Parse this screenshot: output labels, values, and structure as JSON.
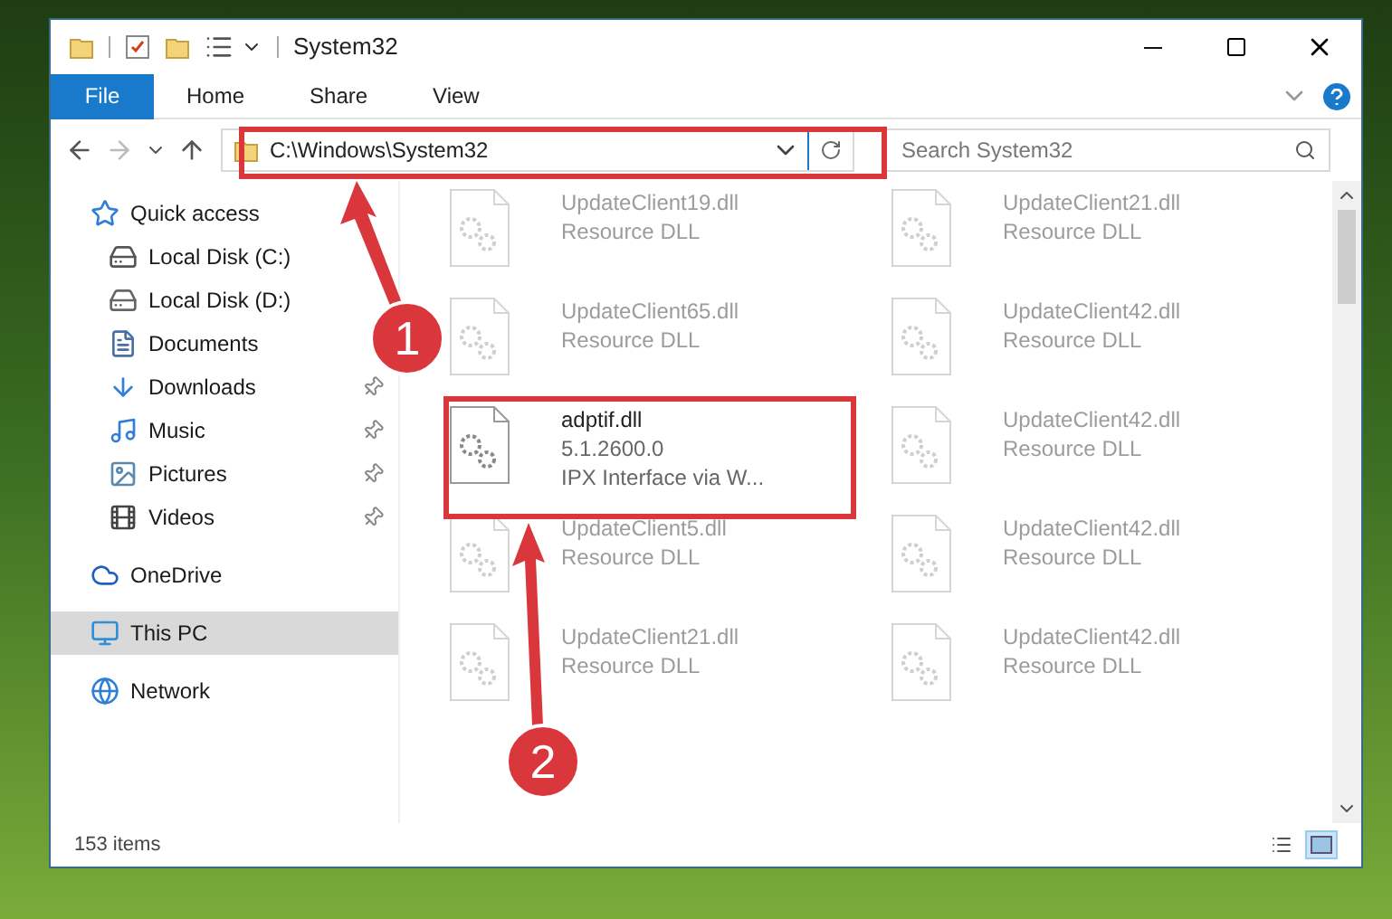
{
  "window": {
    "title": "System32"
  },
  "ribbon_tabs": [
    {
      "label": "File",
      "selected": true
    },
    {
      "label": "Home",
      "selected": false
    },
    {
      "label": "Share",
      "selected": false
    },
    {
      "label": "View",
      "selected": false
    }
  ],
  "address_bar": {
    "path": "C:\\Windows\\System32"
  },
  "search": {
    "placeholder": "Search System32"
  },
  "sidebar": {
    "items": [
      {
        "label": "Quick access",
        "kind": "quick",
        "selected": false,
        "children": [
          {
            "label": "Local Disk (C:)",
            "kind": "diskc",
            "pinned": false
          },
          {
            "label": "Local Disk (D:)",
            "kind": "disk",
            "pinned": false
          },
          {
            "label": "Documents",
            "kind": "documents",
            "pinned": false
          },
          {
            "label": "Downloads",
            "kind": "downloads",
            "pinned": true
          },
          {
            "label": "Music",
            "kind": "music",
            "pinned": true
          },
          {
            "label": "Pictures",
            "kind": "pictures",
            "pinned": true
          },
          {
            "label": "Videos",
            "kind": "videos",
            "pinned": true
          }
        ]
      },
      {
        "label": "OneDrive",
        "kind": "cloud",
        "selected": false
      },
      {
        "label": "This PC",
        "kind": "pc",
        "selected": true
      },
      {
        "label": "Network",
        "kind": "network",
        "selected": false
      }
    ]
  },
  "files": [
    {
      "name": "UpdateClient19.dll",
      "details": [
        "Resource DLL"
      ],
      "faded": true
    },
    {
      "name": "UpdateClient21.dll",
      "details": [
        "Resource DLL"
      ],
      "faded": true
    },
    {
      "name": "UpdateClient65.dll",
      "details": [
        "Resource DLL"
      ],
      "faded": true
    },
    {
      "name": "UpdateClient42.dll",
      "details": [
        "Resource DLL"
      ],
      "faded": true
    },
    {
      "name": "adptif.dll",
      "details": [
        "5.1.2600.0",
        "IPX Interface via W..."
      ],
      "faded": false
    },
    {
      "name": "UpdateClient42.dll",
      "details": [
        "Resource DLL"
      ],
      "faded": true
    },
    {
      "name": "UpdateClient5.dll",
      "details": [
        "Resource DLL"
      ],
      "faded": true
    },
    {
      "name": "UpdateClient42.dll",
      "details": [
        "Resource DLL"
      ],
      "faded": true
    },
    {
      "name": "UpdateClient21.dll",
      "details": [
        "Resource DLL"
      ],
      "faded": true
    },
    {
      "name": "UpdateClient42.dll",
      "details": [
        "Resource DLL"
      ],
      "faded": true
    }
  ],
  "status_bar": {
    "item_count": "153 items",
    "view_buttons": [
      {
        "kind": "details",
        "selected": false
      },
      {
        "kind": "large",
        "selected": true
      }
    ]
  },
  "annotations": [
    {
      "label": "1"
    },
    {
      "label": "2"
    }
  ]
}
